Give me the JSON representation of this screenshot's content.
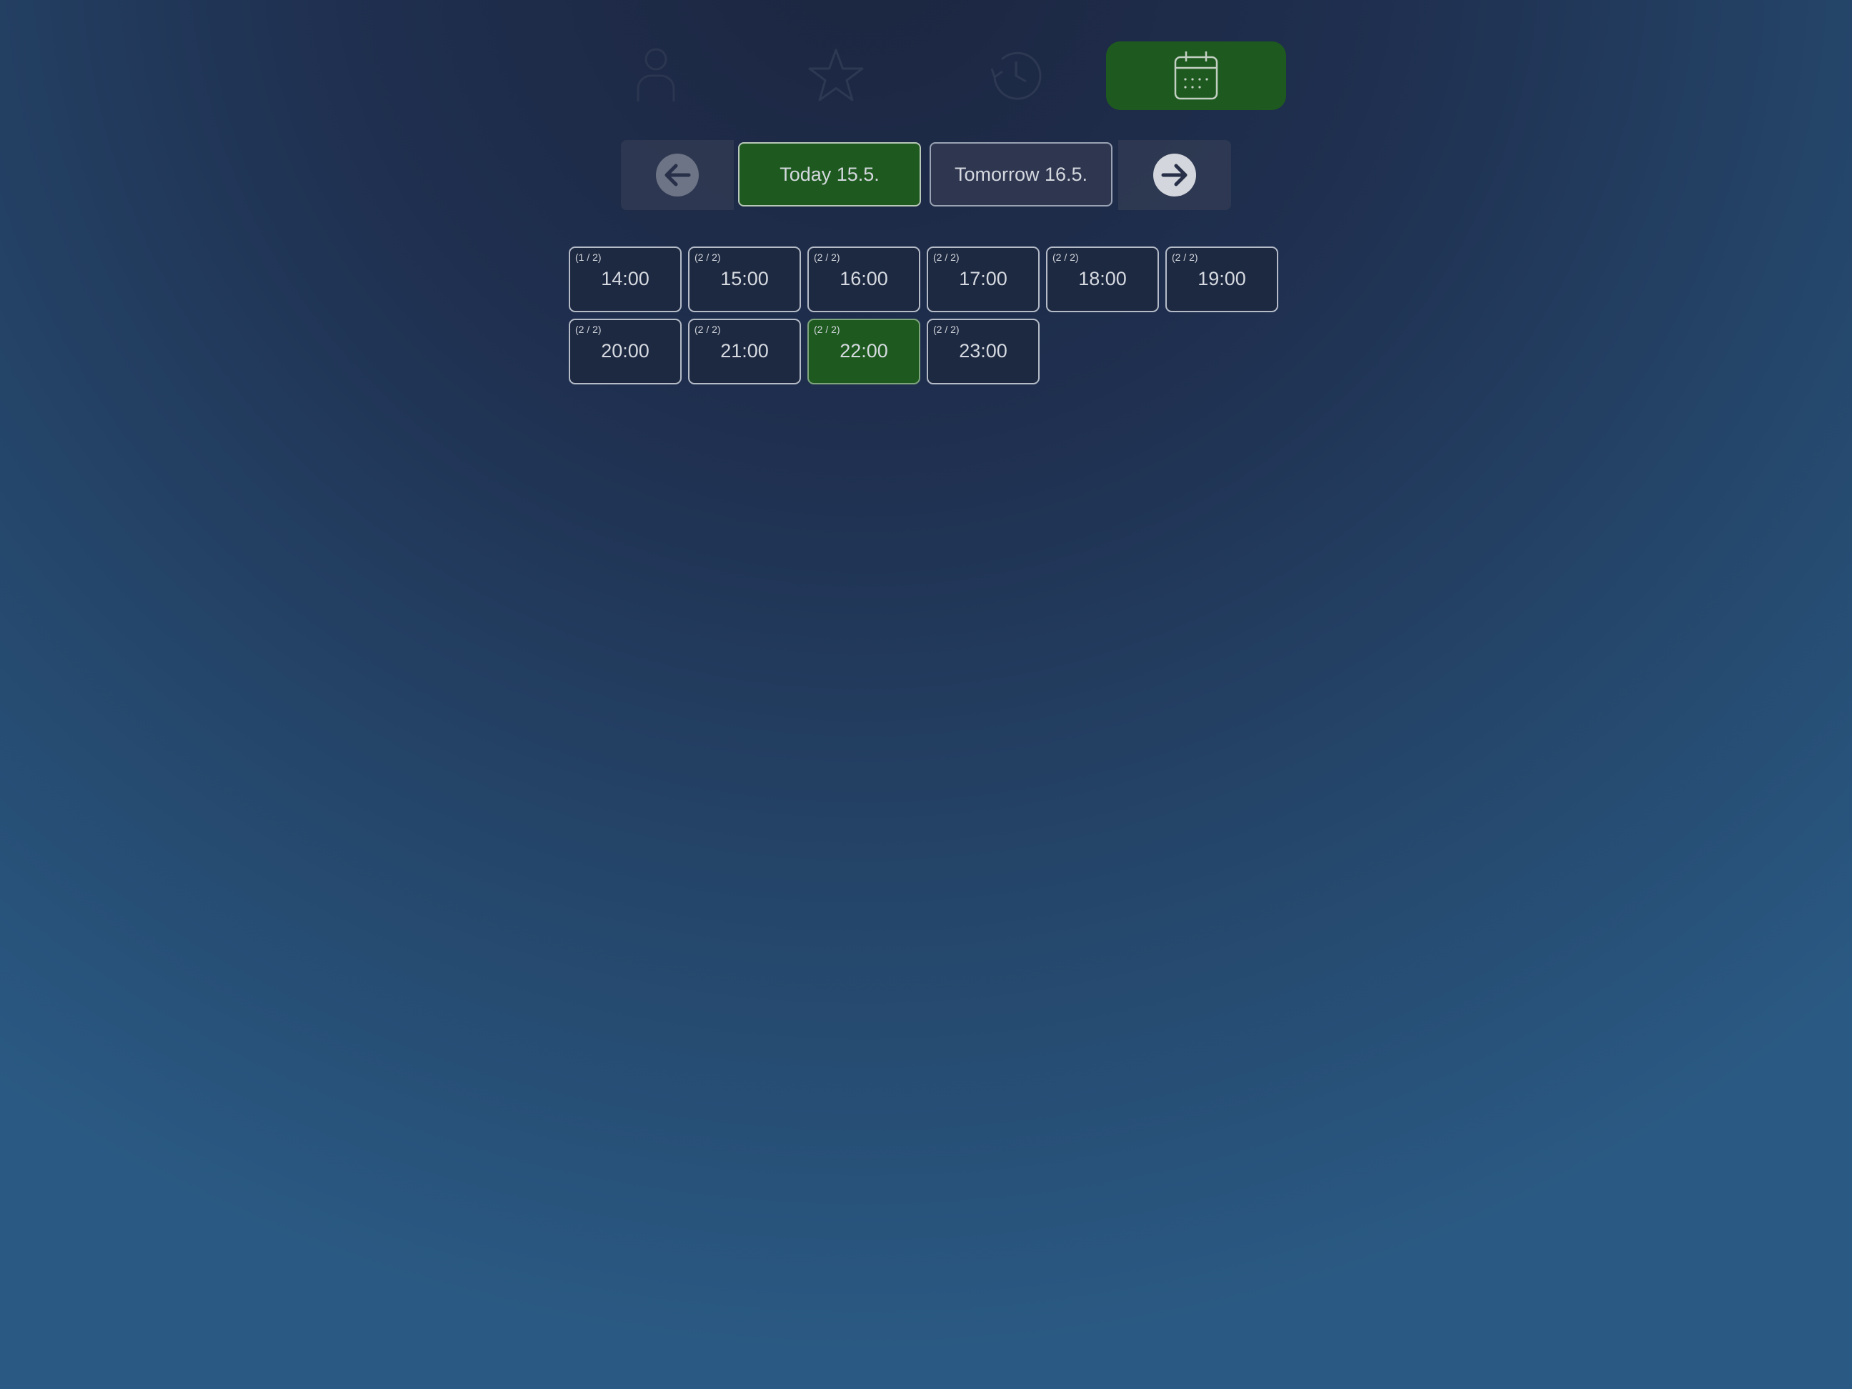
{
  "nav": {
    "items": [
      {
        "icon": "user-icon",
        "active": false
      },
      {
        "icon": "star-icon",
        "active": false
      },
      {
        "icon": "history-icon",
        "active": false
      },
      {
        "icon": "calendar-icon",
        "active": true
      }
    ],
    "active_color": "#1e5a1f"
  },
  "days": {
    "prev_icon": "arrow-left-icon",
    "next_icon": "arrow-right-icon",
    "today_label": "Today 15.5.",
    "tomorrow_label": "Tomorrow 16.5.",
    "selected": "today"
  },
  "slots": [
    {
      "availability": "(1 / 2)",
      "time": "14:00",
      "selected": false
    },
    {
      "availability": "(2 / 2)",
      "time": "15:00",
      "selected": false
    },
    {
      "availability": "(2 / 2)",
      "time": "16:00",
      "selected": false
    },
    {
      "availability": "(2 / 2)",
      "time": "17:00",
      "selected": false
    },
    {
      "availability": "(2 / 2)",
      "time": "18:00",
      "selected": false
    },
    {
      "availability": "(2 / 2)",
      "time": "19:00",
      "selected": false
    },
    {
      "availability": "(2 / 2)",
      "time": "20:00",
      "selected": false
    },
    {
      "availability": "(2 / 2)",
      "time": "21:00",
      "selected": false
    },
    {
      "availability": "(2 / 2)",
      "time": "22:00",
      "selected": true
    },
    {
      "availability": "(2 / 2)",
      "time": "23:00",
      "selected": false
    }
  ],
  "colors": {
    "selected_green": "#1e5a1f",
    "slot_border": "#b5bcc8"
  }
}
